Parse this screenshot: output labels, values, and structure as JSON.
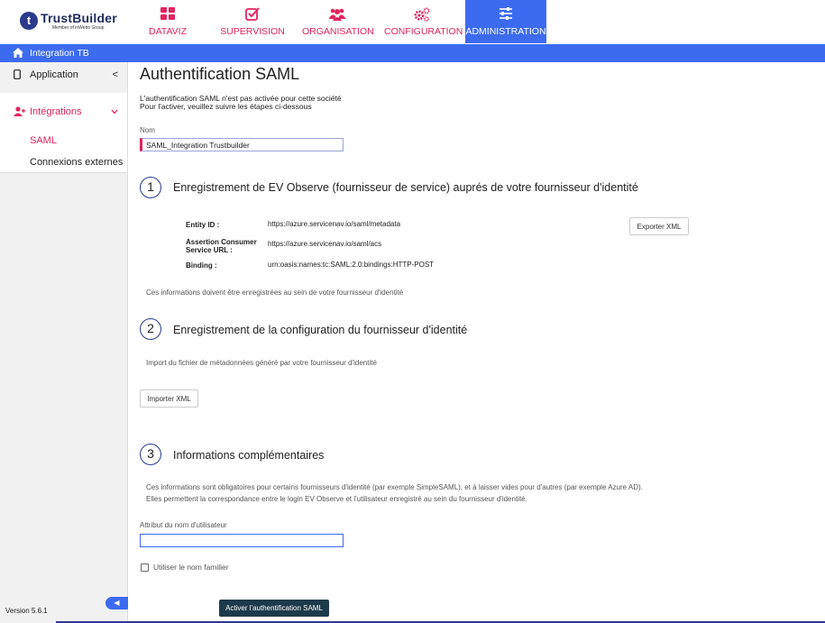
{
  "brand": {
    "name": "TrustBuilder",
    "tagline": "Member of inWebo Group",
    "initial": "t"
  },
  "nav": {
    "tabs": [
      {
        "label": "DATAVIZ",
        "icon": "grid-icon"
      },
      {
        "label": "SUPERVISION",
        "icon": "checkbox-icon"
      },
      {
        "label": "ORGANISATION",
        "icon": "users-icon"
      },
      {
        "label": "CONFIGURATION",
        "icon": "gears-icon"
      },
      {
        "label": "ADMINISTRATION",
        "icon": "sliders-icon",
        "active": true
      }
    ]
  },
  "band": {
    "label": "Integration TB"
  },
  "sidebar": {
    "application": {
      "label": "Application",
      "chevron": "<"
    },
    "integrations": {
      "label": "Intégrations",
      "chevron": "v"
    },
    "sub_items": [
      {
        "label": "SAML",
        "active": true
      },
      {
        "label": "Connexions externes"
      }
    ],
    "version": "Version 5.6.1"
  },
  "page": {
    "title": "Authentification SAML",
    "intro_line1": "L'authentification SAML n'est pas activée pour cette société",
    "intro_line2": "Pour l'activer, veuillez suivre les étapes ci-dessous",
    "name_label": "Nom",
    "name_value": "SAML_Integration Trustbuilder"
  },
  "step1": {
    "number": "1",
    "title": "Enregistrement de EV Observe (fournisseur de service) auprés de votre fournisseur d'identité",
    "entity_id_label": "Entity ID :",
    "entity_id_value": "https://azure.servicenav.io/saml/metadata",
    "acs_label_line1": "Assertion Consumer",
    "acs_label_line2": "Service URL :",
    "acs_value": "https://azure.servicenav.io/saml/acs",
    "binding_label": "Binding :",
    "binding_value": "urn:oasis:names:tc:SAML:2.0:bindings:HTTP-POST",
    "export_button": "Exporter XML",
    "note": "Ces informations doivent être enregistrées au sein de votre fournisseur d'identité"
  },
  "step2": {
    "number": "2",
    "title": "Enregistrement de la configuration du fournisseur d'identité",
    "note": "Import du fichier de métadonnées généré par votre fournisseur d'identité",
    "import_button": "Importer XML"
  },
  "step3": {
    "number": "3",
    "title": "Informations complémentaires",
    "note_line1": "Ces informations sont obligatoires pour certains fournisseurs d'identité (par exemple SimpleSAML), et à laisser vides pour d'autres (par exemple Azure AD).",
    "note_line2": "Elles permettent la correspondance entre le login EV Observe et l'utilisateur enregistré au sein du fournisseur d'identité.",
    "user_attr_label": "Attribut du nom d'utilisateur",
    "user_attr_value": "",
    "familiar_name_label": "Utiliser le nom familier"
  },
  "actions": {
    "activate_button": "Activer l'authentification SAML"
  },
  "colors": {
    "accent": "#3d6bf0",
    "brand_pink": "#e0245e",
    "navy": "#2b3a8c",
    "dark_button": "#1d3a4a"
  }
}
